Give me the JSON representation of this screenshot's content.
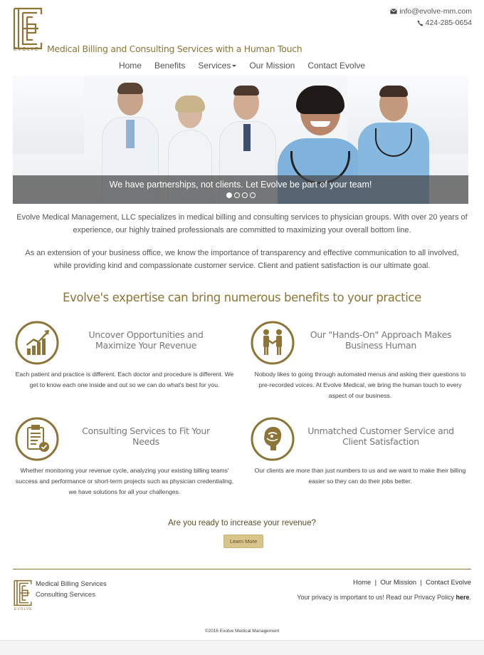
{
  "brand": {
    "logo_word": "EVOLVE",
    "tagline": "Medical Billing and Consulting Services with a Human Touch",
    "color": "#8c7537"
  },
  "contact": {
    "email": "info@evolve-mm.com",
    "phone": "424-285-0654",
    "email_icon": "envelope-icon",
    "phone_icon": "phone-icon"
  },
  "nav": {
    "items": [
      "Home",
      "Benefits",
      "Services",
      "Our Mission",
      "Contact Evolve"
    ]
  },
  "hero": {
    "caption": "We have partnerships, not clients. Let Evolve be part of your team!",
    "slides": 4,
    "active_slide": 1
  },
  "intro": {
    "p1": "Evolve Medical Management, LLC specializes in medical billing and consulting services to physician groups. With over 20 years of experience, our highly trained professionals are committed to maximizing your overall bottom line.",
    "p2": "As an extension of your business office, we know the importance of transparency and effective communication to all involved, while providing kind and compassionate customer service. Client and patient satisfaction is our ultimate goal."
  },
  "benefits": {
    "headline": "Evolve's expertise can bring numerous benefits to your practice",
    "items": [
      {
        "icon": "bar-chart-icon",
        "title": "Uncover Opportunities and Maximize Your Revenue",
        "text": "Each patient and practice is different. Each doctor and procedure is different. We get to know each one inside and out so we can do what's best for you."
      },
      {
        "icon": "handshake-icon",
        "title": "Our \"Hands-On\" Approach Makes Business Human",
        "text": "Nobody likes to going through automated menus and asking their questions to pre-recorded voices. At Evolve Medical, we bring the human touch to every aspect of our business."
      },
      {
        "icon": "clipboard-check-icon",
        "title": "Consulting Services to Fit Your Needs",
        "text": "Whether monitoring your revenue cycle, analyzing your existing billing teams' success and performance or short-term projects such as physician credentialing, we have solutions for all your challenges."
      },
      {
        "icon": "customer-service-icon",
        "title": "Unmatched Customer Service and Client Satisfaction",
        "text": "Our clients are more than just numbers to us and we want to make their billing easier so they can do their jobs better."
      }
    ]
  },
  "cta": {
    "question": "Are you ready to increase your revenue?",
    "button": "Learn More"
  },
  "footer": {
    "links": [
      "Medical Billing Services",
      "Consulting Services"
    ],
    "logo_word": "EVOLVE",
    "nav": [
      "Home",
      "Our Mission",
      "Contact Evolve"
    ],
    "privacy_text": "Your privacy is important to us! Read our Privacy Policy",
    "privacy_link": "here",
    "copyright": "©2016 Evolve Medical Management"
  }
}
